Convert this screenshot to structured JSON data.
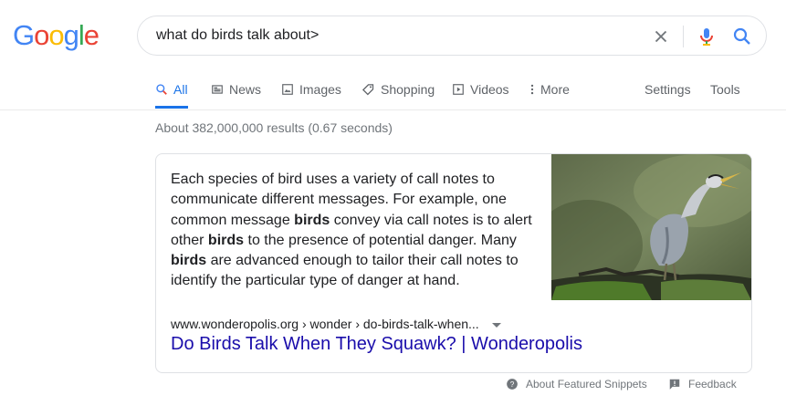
{
  "logo": [
    "G",
    "o",
    "o",
    "g",
    "l",
    "e"
  ],
  "logo_colors": [
    "#4285F4",
    "#EA4335",
    "#FBBC05",
    "#4285F4",
    "#34A853",
    "#EA4335"
  ],
  "search": {
    "query": "what do birds talk about>"
  },
  "icons": {
    "clear": "close-icon",
    "mic": "mic-icon",
    "search": "search-icon"
  },
  "tabs": [
    {
      "label": "All",
      "icon": "search-icon"
    },
    {
      "label": "News",
      "icon": "news-icon"
    },
    {
      "label": "Images",
      "icon": "image-icon"
    },
    {
      "label": "Shopping",
      "icon": "tag-icon"
    },
    {
      "label": "Videos",
      "icon": "play-icon"
    },
    {
      "label": "More",
      "icon": "more-vert-icon"
    }
  ],
  "tab_right": {
    "settings": "Settings",
    "tools": "Tools"
  },
  "result_stats": "About 382,000,000 results (0.67 seconds)",
  "snippet": {
    "segments": [
      "Each species of bird uses a variety of call notes to communicate different messages. For example, one common message ",
      "birds",
      " convey via call notes is to alert other ",
      "birds",
      " to the presence of potential danger. Many ",
      "birds",
      " are advanced enough to tailor their call notes to identify the particular type of danger at hand."
    ],
    "cite": "www.wonderopolis.org › wonder › do-birds-talk-when...",
    "title": "Do Birds Talk When They Squawk? | Wonderopolis",
    "image_alt": "heron bird"
  },
  "footer": {
    "about": "About Featured Snippets",
    "feedback": "Feedback"
  },
  "colors": {
    "accent": "#1a73e8",
    "link": "#1a0dab",
    "muted": "#70757a"
  }
}
